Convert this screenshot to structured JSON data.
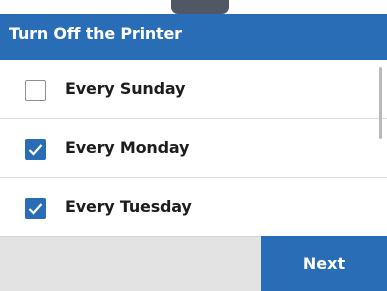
{
  "header": {
    "title": "Turn Off the Printer"
  },
  "options": [
    {
      "label": "Every Sunday",
      "checked": false
    },
    {
      "label": "Every Monday",
      "checked": true
    },
    {
      "label": "Every Tuesday",
      "checked": true
    }
  ],
  "footer": {
    "next_label": "Next"
  },
  "colors": {
    "accent": "#2a6db7",
    "footer_bg": "#e3e3e3",
    "text": "#1d1d1d"
  },
  "icons": {
    "check": "checkmark-icon"
  }
}
